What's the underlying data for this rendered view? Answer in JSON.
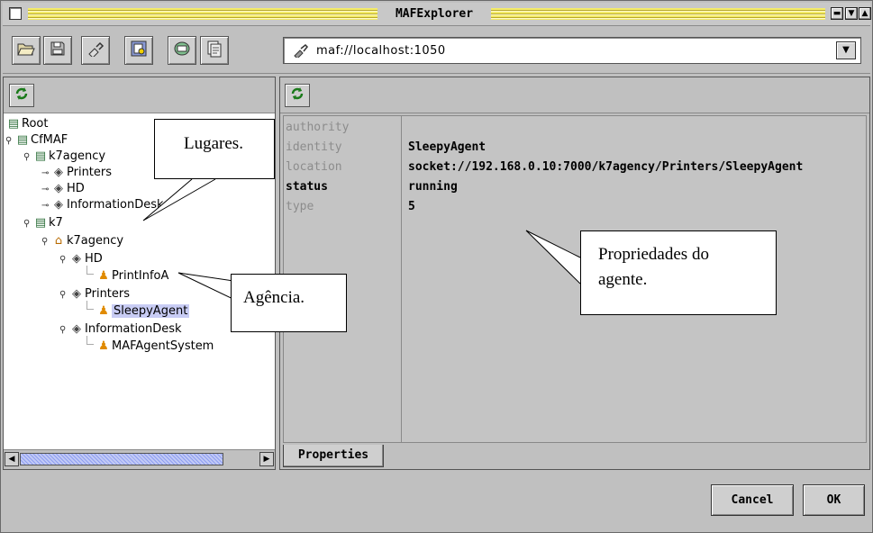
{
  "window": {
    "title": "MAFExplorer"
  },
  "toolbar": {
    "buttons": [
      {
        "name": "open-folder-icon",
        "glyph": "🗁"
      },
      {
        "name": "save-disk-icon",
        "glyph": "💾"
      },
      {
        "name": "connect-plug-icon",
        "glyph": "✎"
      },
      {
        "name": "new-document-icon",
        "glyph": "⬛"
      },
      {
        "name": "place-folder-icon",
        "glyph": "🗀"
      },
      {
        "name": "properties-icon",
        "glyph": "🗐"
      }
    ],
    "url": "maf://localhost:1050"
  },
  "tree": {
    "nodes": [
      {
        "label": "Root",
        "icon": "folder-icon"
      },
      {
        "label": "CfMAF",
        "icon": "folder-icon"
      },
      {
        "label": "k7agency",
        "icon": "folder-icon"
      },
      {
        "label": "Printers",
        "icon": "place-icon"
      },
      {
        "label": "HD",
        "icon": "place-icon"
      },
      {
        "label": "InformationDesk",
        "icon": "place-icon"
      },
      {
        "label": "k7",
        "icon": "folder-icon"
      },
      {
        "label": "k7agency",
        "icon": "home-icon"
      },
      {
        "label": "HD",
        "icon": "place-icon"
      },
      {
        "label": "PrintInfoA",
        "icon": "agent-icon"
      },
      {
        "label": "Printers",
        "icon": "place-icon"
      },
      {
        "label": "SleepyAgent",
        "icon": "agent-icon",
        "selected": true
      },
      {
        "label": "InformationDesk",
        "icon": "place-icon"
      },
      {
        "label": "MAFAgentSystem",
        "icon": "agent-icon"
      }
    ]
  },
  "properties": {
    "rows": [
      {
        "key": "authority",
        "value": ""
      },
      {
        "key": "identity",
        "value": "SleepyAgent"
      },
      {
        "key": "location",
        "value": "socket://192.168.0.10:7000/k7agency/Printers/SleepyAgent"
      },
      {
        "key": "status",
        "value": "running"
      },
      {
        "key": "type",
        "value": "5"
      }
    ],
    "tab": "Properties"
  },
  "buttons": {
    "cancel": "Cancel",
    "ok": "OK"
  },
  "annotations": {
    "lugares": "Lugares.",
    "agencia": "Agência.",
    "propriedades_line1": "Propriedades do",
    "propriedades_line2": "agente."
  }
}
